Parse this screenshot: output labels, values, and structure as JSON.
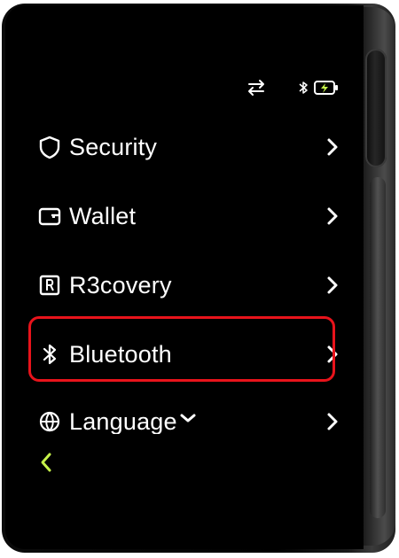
{
  "status": {
    "transfer_icon": "transfer-arrows-icon",
    "bluetooth_icon": "bluetooth-icon",
    "battery_icon": "battery-charging-icon",
    "accent_color": "#c6f24a"
  },
  "menu": {
    "items": [
      {
        "label": "Security",
        "icon": "shield-icon"
      },
      {
        "label": "Wallet",
        "icon": "wallet-icon"
      },
      {
        "label": "R3covery",
        "icon": "recovery-icon"
      },
      {
        "label": "Bluetooth",
        "icon": "bluetooth-icon"
      },
      {
        "label": "Language",
        "icon": "globe-icon"
      }
    ],
    "highlight_color": "#e8131b"
  },
  "footer": {
    "back_icon": "chevron-left-icon"
  }
}
